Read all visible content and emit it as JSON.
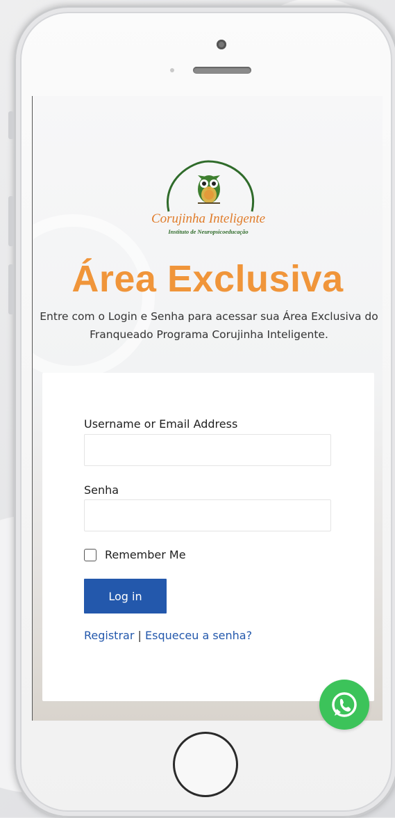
{
  "logo": {
    "name": "Corujinha Inteligente",
    "tagline": "Instituto de Neuropsicoeducação"
  },
  "page": {
    "title": "Área Exclusiva",
    "subtitle": "Entre com o Login e Senha para acessar sua Área Exclusiva do Franqueado Programa Corujinha Inteligente."
  },
  "form": {
    "username_label": "Username or Email Address",
    "username_value": "",
    "password_label": "Senha",
    "password_value": "",
    "remember_label": "Remember Me",
    "remember_checked": false,
    "login_button": "Log in",
    "register_link": "Registrar",
    "separator": "|",
    "forgot_link": "Esqueceu a senha?"
  },
  "colors": {
    "title_orange": "#f0953a",
    "button_blue": "#2358ac",
    "whatsapp_green": "#3cc35a",
    "logo_green": "#2f6b2a"
  },
  "icons": {
    "whatsapp": "whatsapp-icon",
    "owl": "owl-logo-icon"
  }
}
